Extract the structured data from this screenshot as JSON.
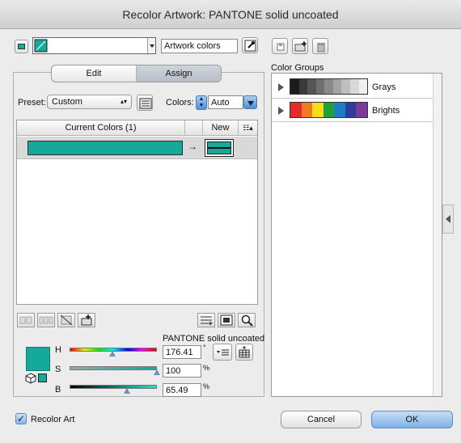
{
  "window": {
    "title": "Recolor Artwork: PANTONE solid uncoated"
  },
  "top": {
    "artwork_field": "Artwork colors",
    "eyedropper_icon": "eyedropper-icon"
  },
  "tabs": {
    "edit": "Edit",
    "assign": "Assign"
  },
  "controls": {
    "preset_label": "Preset:",
    "preset_value": "Custom",
    "colors_label": "Colors:",
    "colors_value": "Auto"
  },
  "table": {
    "header_current": "Current Colors (1)",
    "header_new": "New",
    "arrow": "→",
    "current_color": "#14a99a",
    "new_color": "#14a99a"
  },
  "picker": {
    "library": "PANTONE solid uncoated",
    "H_label": "H",
    "S_label": "S",
    "B_label": "B",
    "H_value": "176.41",
    "S_value": "100",
    "B_value": "65.49",
    "deg_unit": "°",
    "pct_unit": "%",
    "swatch_color": "#14a99a",
    "H_level": 0.49,
    "S_level": 1.0,
    "B_level": 0.6549
  },
  "color_groups": {
    "header": "Color Groups",
    "groups": [
      {
        "name": "Grays",
        "swatches": [
          "#1c1c1c",
          "#3a3a3a",
          "#565656",
          "#707070",
          "#8a8a8a",
          "#a4a4a4",
          "#bebebe",
          "#d8d8d8",
          "#f0f0f0"
        ]
      },
      {
        "name": "Brights",
        "swatches": [
          "#e52c29",
          "#f07a21",
          "#f5df1a",
          "#22a038",
          "#1f7cc2",
          "#2a3e9b",
          "#7b3a98"
        ]
      }
    ]
  },
  "footer": {
    "recolor_art_label": "Recolor Art",
    "recolor_checked": true,
    "cancel": "Cancel",
    "ok": "OK"
  },
  "colors": {
    "accent": "#14a99a",
    "ok_button": "#7fb1e8"
  }
}
